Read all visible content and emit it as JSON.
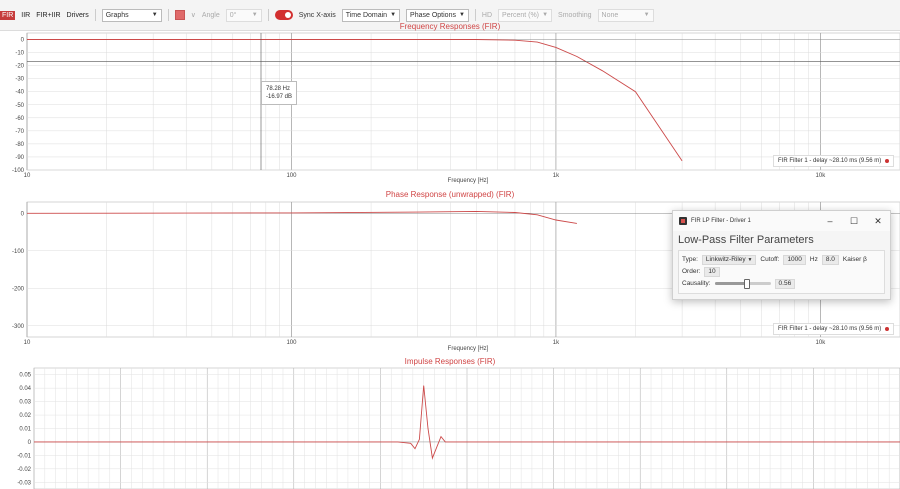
{
  "toolbar": {
    "tabs": [
      "FIR",
      "IIR",
      "FIR+IIR",
      "Drivers"
    ],
    "view_select": "Graphs",
    "angle_label": "Angle",
    "angle_value": "0°",
    "sync_label": "Sync X-axis",
    "time_domain": "Time Domain",
    "phase_options": "Phase Options",
    "hd_label": "HD",
    "percent_select": "Percent (%)",
    "smoothing_label": "Smoothing",
    "smoothing_select": "None"
  },
  "accent": "#c63b3b",
  "curve_color": "#cc4a4a",
  "freq_plot": {
    "title": "Frequency Responses (FIR)",
    "x_title": "Frequency [Hz]",
    "y_ticks": [
      "0",
      "-10",
      "-20",
      "-30",
      "-40",
      "-50",
      "-60",
      "-70",
      "-80",
      "-90",
      "-100"
    ],
    "x_ticks": [
      "10",
      "100",
      "1k",
      "10k"
    ],
    "legend": "FIR Filter 1 - delay ~28.10 ms (9.56 m)",
    "tooltip": {
      "freq": "78.28 Hz",
      "value": "-16.97 dB"
    }
  },
  "phase_plot": {
    "title": "Phase Response (unwrapped) (FIR)",
    "x_title": "Frequency [Hz]",
    "y_ticks": [
      "0",
      "-100",
      "-200",
      "-300"
    ],
    "x_ticks": [
      "10",
      "100",
      "1k",
      "10k"
    ],
    "legend": "FIR Filter 1 - delay ~28.10 ms (9.56 m)"
  },
  "impulse_plot": {
    "title": "Impulse Responses (FIR)",
    "y_ticks": [
      "0.05",
      "0.04",
      "0.03",
      "0.02",
      "0.01",
      "0",
      "-0.01",
      "-0.02",
      "-0.03"
    ]
  },
  "dialog": {
    "title": "FIR LP Filter - Driver 1",
    "min": "–",
    "max": "☐",
    "close": "✕",
    "heading": "Low-Pass Filter Parameters",
    "type_label": "Type:",
    "type_value": "Linkwitz-Riley",
    "cutoff_label": "Cutoff:",
    "cutoff_value": "1000",
    "cutoff_unit": "Hz",
    "kaiser_value": "8.0",
    "kaiser_label": "Kaiser β",
    "order_label": "Order:",
    "order_value": "10",
    "causality_label": "Causality:",
    "causality_value": "0.56"
  },
  "chart_data": [
    {
      "type": "line",
      "title": "Frequency Responses (FIR)",
      "xlabel": "Frequency [Hz]",
      "ylabel": "",
      "x_scale": "log",
      "xlim": [
        10,
        20000
      ],
      "ylim": [
        -100,
        5
      ],
      "series": [
        {
          "name": "FIR Filter 1 - delay ~28.10 ms (9.56 m)",
          "x": [
            10,
            100,
            500,
            700,
            850,
            1000,
            1200,
            1500,
            2000,
            3000
          ],
          "y": [
            0,
            0,
            0,
            -0.5,
            -2,
            -6,
            -13,
            -24,
            -40,
            -93
          ]
        }
      ]
    },
    {
      "type": "line",
      "title": "Phase Response (unwrapped) (FIR)",
      "xlabel": "Frequency [Hz]",
      "ylabel": "",
      "x_scale": "log",
      "xlim": [
        10,
        20000
      ],
      "ylim": [
        -330,
        30
      ],
      "series": [
        {
          "name": "FIR Filter 1 - delay ~28.10 ms (9.56 m)",
          "x": [
            10,
            100,
            300,
            500,
            700,
            850,
            1000,
            1200
          ],
          "y": [
            0,
            1,
            3,
            5,
            2,
            -4,
            -18,
            -27
          ]
        }
      ]
    },
    {
      "type": "line",
      "title": "Impulse Responses (FIR)",
      "xlabel": "",
      "ylabel": "",
      "xlim": [
        0,
        1
      ],
      "ylim": [
        -0.035,
        0.055
      ],
      "series": [
        {
          "name": "",
          "x": [
            0,
            0.42,
            0.435,
            0.44,
            0.445,
            0.45,
            0.455,
            0.46,
            0.465,
            0.47,
            0.475,
            0.49,
            1
          ],
          "y": [
            0,
            0,
            -0.001,
            -0.005,
            0.002,
            0.042,
            0.01,
            -0.012,
            -0.004,
            0.004,
            0,
            0,
            0
          ]
        }
      ]
    }
  ]
}
